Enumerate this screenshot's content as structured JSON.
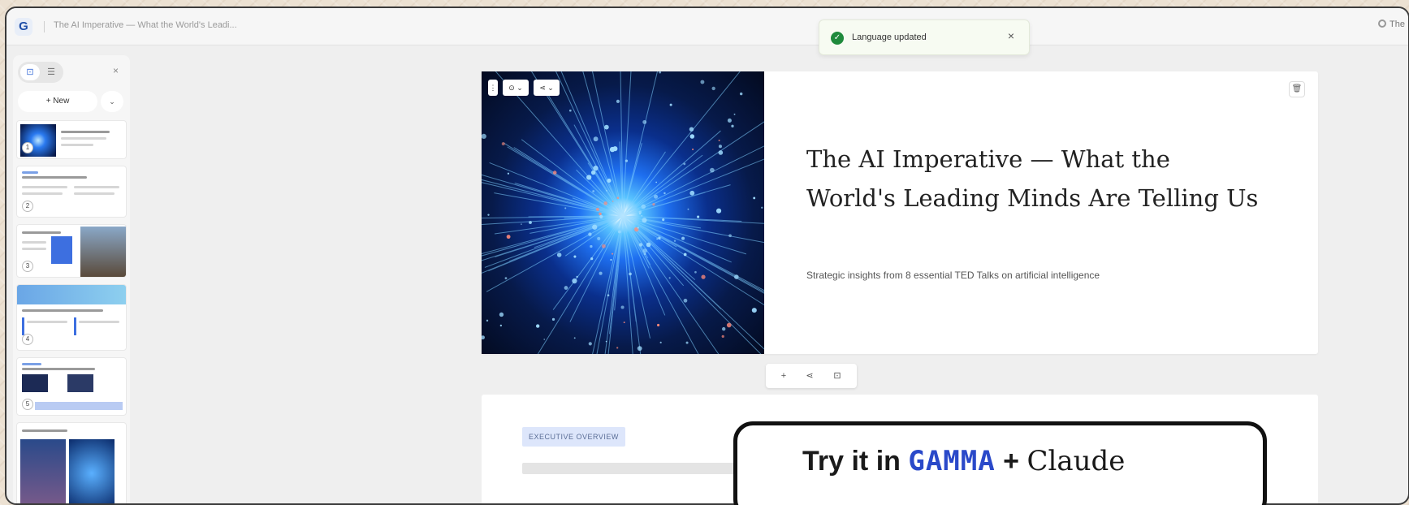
{
  "topbar": {
    "logo": "G",
    "doc_title": "The AI Imperative — What the World's Leadi...",
    "theme_label": "The"
  },
  "toast": {
    "message": "Language updated",
    "close": "×"
  },
  "sidebar": {
    "view_toggle": [
      "⊡",
      "☰"
    ],
    "close": "×",
    "new_label": "+  New",
    "new_caret": "⌄",
    "thumbnails": [
      "1",
      "2",
      "3",
      "4",
      "5"
    ]
  },
  "slide1": {
    "title": "The AI Imperative — What the World's Leading Minds Are Telling Us",
    "subtitle": "Strategic insights from 8 essential TED Talks on artificial intelligence",
    "hero_tools": [
      "⋮",
      "⊙ ⌄",
      "⋖ ⌄"
    ],
    "delete_icon": "🗑"
  },
  "mini_toolbar": [
    "+",
    "⋖",
    "⊡"
  ],
  "slide2": {
    "tag": "EXECUTIVE OVERVIEW"
  },
  "promo": {
    "prefix": "Try it in ",
    "brand1": "GAMMA",
    "plus": " + ",
    "brand2": "Claude"
  },
  "colors": {
    "accent": "#2a49c9",
    "success": "#1f8a3c",
    "tag_bg": "#dde6fb"
  }
}
